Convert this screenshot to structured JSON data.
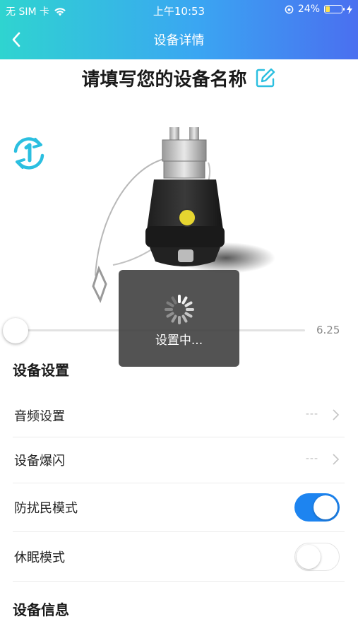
{
  "status_bar": {
    "carrier": "无 SIM 卡",
    "time": "上午10:53",
    "battery": "24%"
  },
  "nav": {
    "title": "设备详情"
  },
  "device": {
    "name": "请填写您的设备名称"
  },
  "slider": {
    "value": "6.25",
    "position_fraction": 0
  },
  "settings": {
    "title": "设备设置",
    "rows": [
      {
        "label": "音频设置",
        "value": "---"
      },
      {
        "label": "设备爆闪",
        "value": "---"
      }
    ],
    "toggles": [
      {
        "label": "防扰民模式",
        "on": true
      },
      {
        "label": "休眠模式",
        "on": false
      }
    ]
  },
  "info": {
    "title": "设备信息"
  },
  "overlay": {
    "text": "设置中..."
  },
  "colors": {
    "accent": "#1d84f0",
    "header_start": "#2fd4d0",
    "header_end": "#4a6ff0",
    "icon_teal": "#2bbfe0"
  },
  "icons": {
    "back": "chevron-left-icon",
    "edit": "edit-icon",
    "rotate": "rotate-one-icon",
    "chevron": "chevron-right-icon",
    "spinner": "loading-spinner-icon"
  }
}
